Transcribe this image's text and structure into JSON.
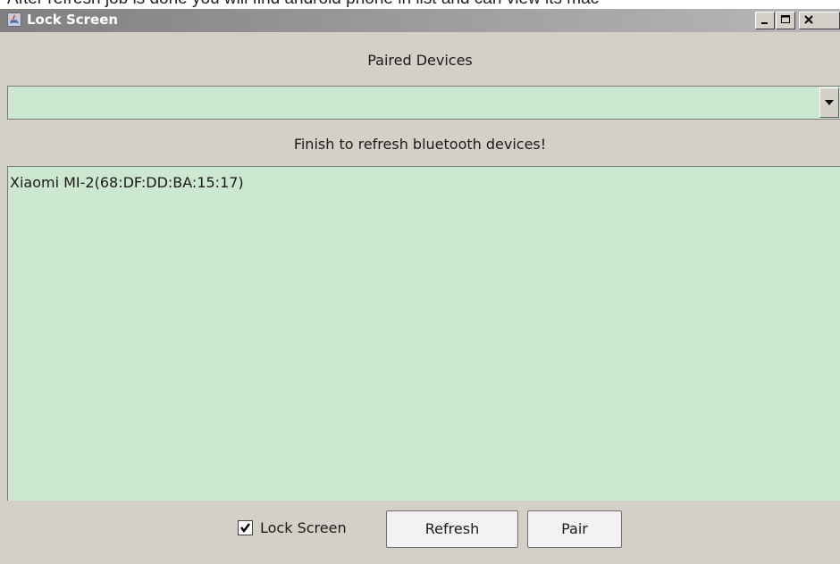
{
  "page": {
    "caption": "After refresh job is done you will find android phone in list and can view its mac"
  },
  "window": {
    "title": "Lock Screen",
    "icon": "java-app-icon",
    "controls": [
      "minimize-icon",
      "maximize-icon",
      "close-icon"
    ]
  },
  "paired_devices": {
    "label": "Paired Devices",
    "dropdown": {
      "selected": "",
      "arrow_icon": "chevron-down-icon"
    }
  },
  "status": {
    "text": "Finish to refresh bluetooth devices!"
  },
  "device_list": {
    "items": [
      {
        "label": "Xiaomi MI-2(68:DF:DD:BA:15:17)"
      }
    ]
  },
  "bottom_bar": {
    "lock_screen": {
      "label": "Lock Screen",
      "checked": true
    },
    "refresh_label": "Refresh",
    "pair_label": "Pair"
  },
  "colors": {
    "window_bg": "#d4d0c8",
    "list_bg": "#cce8d0",
    "titlebar_start": "#808080",
    "titlebar_end": "#b8b8b8"
  }
}
